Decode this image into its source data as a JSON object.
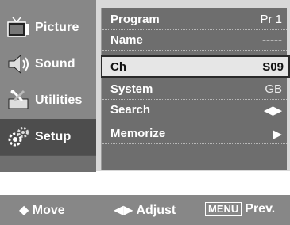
{
  "sidebar": {
    "items": [
      {
        "label": "Picture",
        "icon": "tv-icon"
      },
      {
        "label": "Sound",
        "icon": "speaker-icon"
      },
      {
        "label": "Utilities",
        "icon": "tools-icon"
      },
      {
        "label": "Setup",
        "icon": "gears-icon",
        "active": true
      }
    ]
  },
  "menu": {
    "rows": [
      {
        "label": "Program",
        "value": "Pr 1"
      },
      {
        "label": "Name",
        "value": "-----"
      },
      {
        "label": "Ch",
        "value": "S09",
        "selected": true
      },
      {
        "label": "System",
        "value": "GB"
      },
      {
        "label": "Search",
        "value": "◀▶"
      },
      {
        "label": "Memorize",
        "value": "▶"
      }
    ]
  },
  "footer": {
    "move_icon": "◆",
    "move_label": "Move",
    "adjust_icon": "◀▶",
    "adjust_label": "Adjust",
    "menu_key": "MENU",
    "prev_label": "Prev."
  }
}
